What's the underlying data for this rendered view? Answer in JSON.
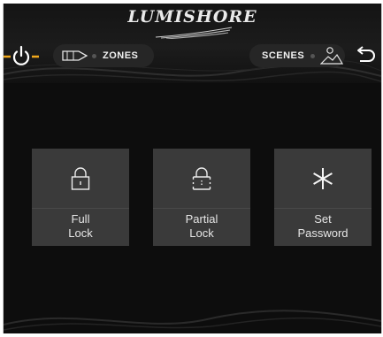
{
  "brand": {
    "name": "LUMISHORE"
  },
  "nav": {
    "zones_label": "ZONES",
    "scenes_label": "SCENES"
  },
  "tiles": [
    {
      "label_line1": "Full",
      "label_line2": "Lock",
      "icon": "lock-icon"
    },
    {
      "label_line1": "Partial",
      "label_line2": "Lock",
      "icon": "partial-lock-icon"
    },
    {
      "label_line1": "Set",
      "label_line2": "Password",
      "icon": "asterisk-icon"
    }
  ],
  "colors": {
    "background": "#0d0d0d",
    "tile": "#3a3a3a",
    "power_accent": "#f0a81c",
    "text": "#e6e6e6"
  }
}
